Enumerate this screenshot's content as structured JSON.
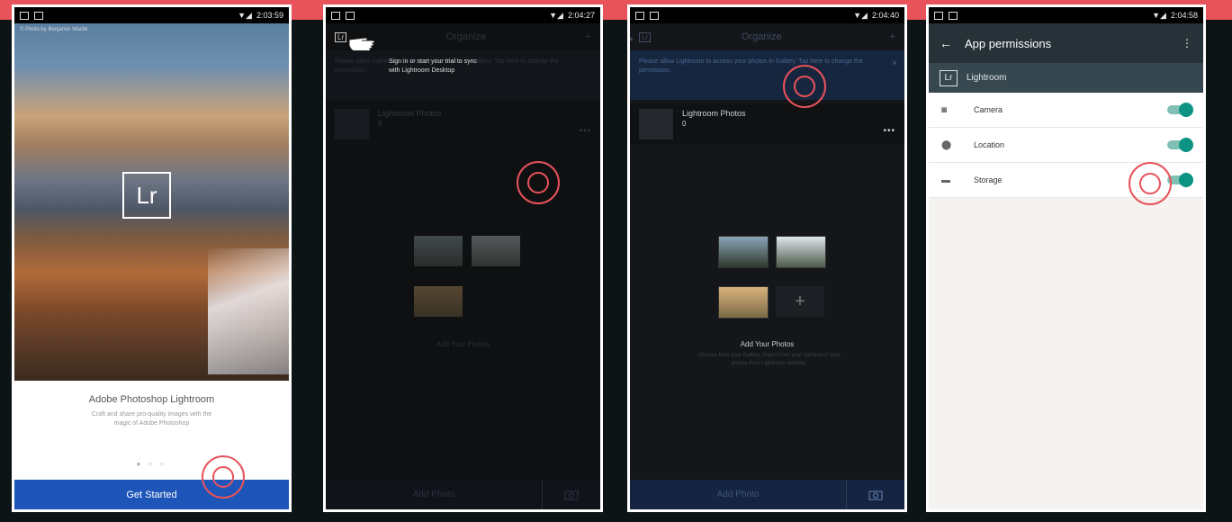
{
  "phones": [
    {
      "status": {
        "time": "2:03:59"
      },
      "photo_credit": "© Photo by Benjamin Warde",
      "logo": "Lr",
      "app_title": "Adobe Photoshop Lightroom",
      "app_subtitle": "Craft and share pro-quality images with the magic of Adobe Photoshop",
      "pager": "● ○ ○",
      "get_started": "Get Started"
    },
    {
      "status": {
        "time": "2:04:27"
      },
      "title": "Organize",
      "banner_dim": "Please allow Lightroom to access your photos in Gallery. Tap here to change the permission.",
      "banner_highlight_1": "Sign in or start your trial to sync",
      "banner_highlight_2": "with Lightroom Desktop",
      "album_name": "Lightroom Photos",
      "album_count": "0",
      "more": "•••",
      "add_label": "Add Your Photos",
      "add_photo": "Add Photo"
    },
    {
      "status": {
        "time": "2:04:40"
      },
      "title": "Organize",
      "plus": "+",
      "banner": "Please allow Lightroom to access your photos in Gallery. Tap here to change the permission.",
      "close": "×",
      "album_name": "Lightroom Photos",
      "album_count": "0",
      "more": "•••",
      "add_label": "Add Your Photos",
      "add_desc": "Choose from your Gallery, import from your camera or sync photos from Lightroom desktop.",
      "plus_tile": "+",
      "add_photo": "Add Photo"
    },
    {
      "status": {
        "time": "2:04:58"
      },
      "back": "←",
      "title": "App permissions",
      "menu": "⋮",
      "app_logo": "Lr",
      "app_name": "Lightroom",
      "permissions": [
        {
          "label": "Camera",
          "icon": "camera-icon",
          "enabled": true
        },
        {
          "label": "Location",
          "icon": "location-icon",
          "enabled": true
        },
        {
          "label": "Storage",
          "icon": "folder-icon",
          "enabled": true
        }
      ]
    }
  ],
  "colors": {
    "accent": "#e8525a",
    "blue": "#1d56b8",
    "teal": "#0d9384"
  }
}
